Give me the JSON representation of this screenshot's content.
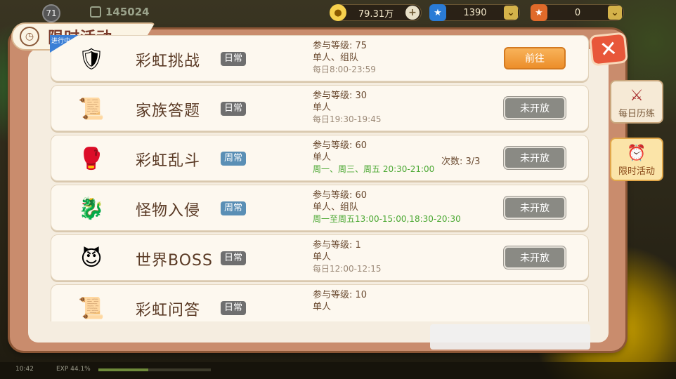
{
  "hud": {
    "level": "71",
    "power": "145024",
    "gold": "79.31万",
    "diamond": "1390",
    "ticket": "0"
  },
  "panel": {
    "title": "限时活动",
    "close": "✕"
  },
  "side_tabs": [
    {
      "label": "每日历练"
    },
    {
      "label": "限时活动"
    }
  ],
  "activities": [
    {
      "name": "彩虹挑战",
      "freq": "日常",
      "freq_type": "daily",
      "level": "参与等级:   75",
      "mode": "单人、组队",
      "time": "每日8:00-23:59",
      "time_green": false,
      "count": "",
      "button": "前往",
      "button_type": "go",
      "ribbon": "进行中",
      "icon": "🛡"
    },
    {
      "name": "家族答题",
      "freq": "日常",
      "freq_type": "daily",
      "level": "参与等级:   30",
      "mode": "单人",
      "time": "每日19:30-19:45",
      "time_green": false,
      "count": "",
      "button": "未开放",
      "button_type": "closed",
      "ribbon": "",
      "icon": "📜"
    },
    {
      "name": "彩虹乱斗",
      "freq": "周常",
      "freq_type": "weekly",
      "level": "参与等级:   60",
      "mode": "单人",
      "time": "周一、周三、周五 20:30-21:00",
      "time_green": true,
      "count": "次数: 3/3",
      "button": "未开放",
      "button_type": "closed",
      "ribbon": "",
      "icon": "🥊"
    },
    {
      "name": "怪物入侵",
      "freq": "周常",
      "freq_type": "weekly",
      "level": "参与等级:   60",
      "mode": "单人、组队",
      "time": "周一至周五13:00-15:00,18:30-20:30",
      "time_green": true,
      "count": "",
      "button": "未开放",
      "button_type": "closed",
      "ribbon": "",
      "icon": "🐉"
    },
    {
      "name": "世界BOSS",
      "freq": "日常",
      "freq_type": "daily",
      "level": "参与等级:   1",
      "mode": "单人",
      "time": "每日12:00-12:15",
      "time_green": false,
      "count": "",
      "button": "未开放",
      "button_type": "closed",
      "ribbon": "",
      "icon": "😈"
    },
    {
      "name": "彩虹问答",
      "freq": "日常",
      "freq_type": "daily",
      "level": "参与等级:   10",
      "mode": "单人",
      "time": "",
      "time_green": false,
      "count": "",
      "button": "",
      "button_type": "closed",
      "ribbon": "",
      "icon": "📜"
    }
  ],
  "bottom": {
    "clock": "10:42",
    "exp": "EXP 44.1%",
    "exp_fraction": 0.441
  },
  "colors": {
    "panel_frame": "#c98c6d",
    "panel_bg": "#f5ede0",
    "go_button": "#ec8e2a",
    "closed_button": "#8a8a84",
    "daily_tag": "#6f6f6f",
    "weekly_tag": "#5a8fb5",
    "green_time": "#4aa832"
  }
}
